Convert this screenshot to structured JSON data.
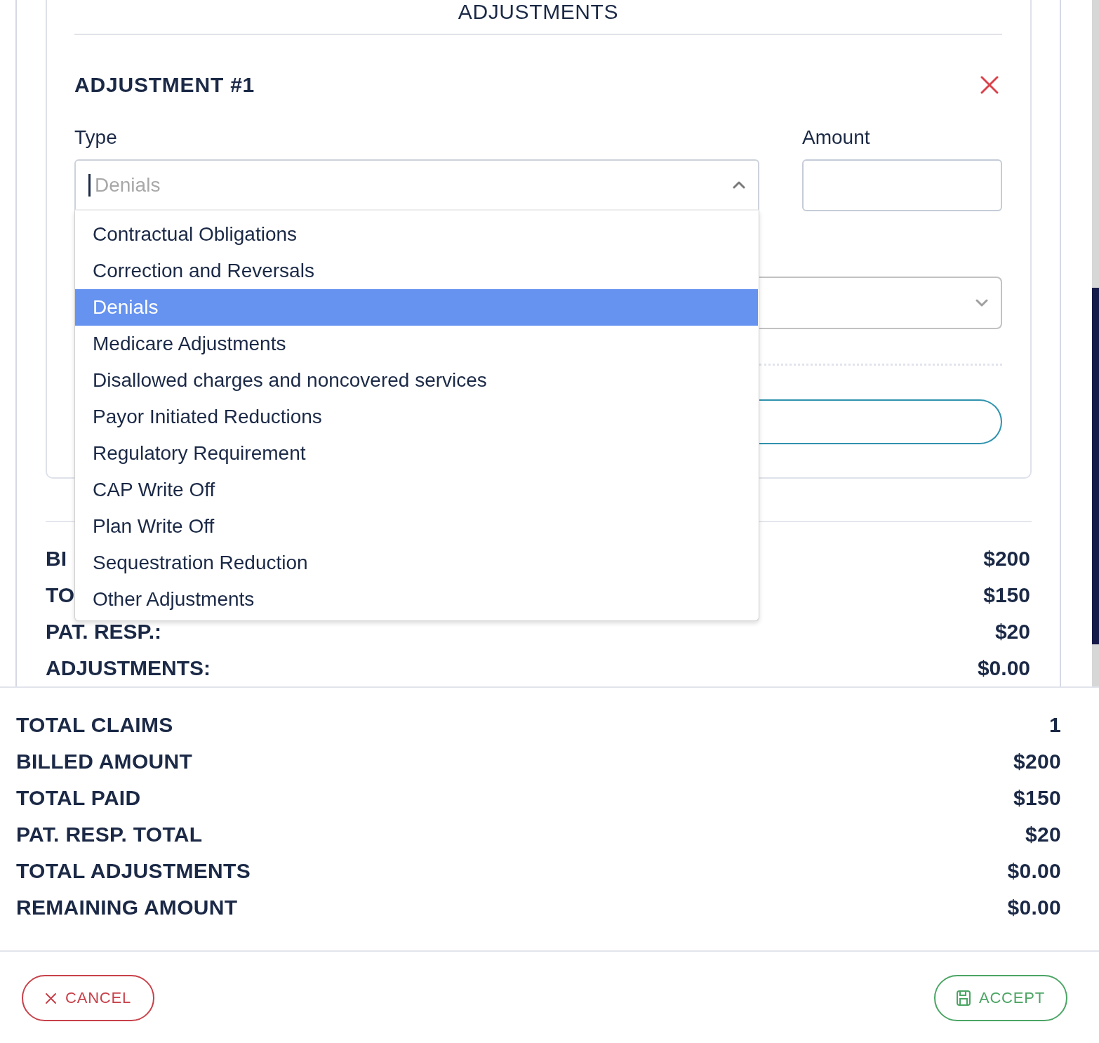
{
  "section_title": "ADJUSTMENTS",
  "adjustment": {
    "title": "ADJUSTMENT #1",
    "type_field": {
      "label": "Type",
      "placeholder": "Denials",
      "expanded": true,
      "options": [
        {
          "label": "Contractual Obligations",
          "selected": false
        },
        {
          "label": "Correction and Reversals",
          "selected": false
        },
        {
          "label": "Denials",
          "selected": true
        },
        {
          "label": "Medicare Adjustments",
          "selected": false
        },
        {
          "label": "Disallowed charges and noncovered services",
          "selected": false
        },
        {
          "label": "Payor Initiated Reductions",
          "selected": false
        },
        {
          "label": "Regulatory Requirement",
          "selected": false
        },
        {
          "label": "CAP Write Off",
          "selected": false
        },
        {
          "label": "Plan Write Off",
          "selected": false
        },
        {
          "label": "Sequestration Reduction",
          "selected": false
        },
        {
          "label": "Other Adjustments",
          "selected": false
        }
      ]
    },
    "amount_field": {
      "label": "Amount"
    }
  },
  "claim_summary": [
    {
      "label": "BI",
      "value": "$200"
    },
    {
      "label": "TO",
      "value": "$150"
    },
    {
      "label": "PAT. RESP.:",
      "value": "$20"
    },
    {
      "label": "ADJUSTMENTS:",
      "value": "$0.00"
    }
  ],
  "totals": [
    {
      "label": "TOTAL CLAIMS",
      "value": "1"
    },
    {
      "label": "BILLED AMOUNT",
      "value": "$200"
    },
    {
      "label": "TOTAL PAID",
      "value": "$150"
    },
    {
      "label": "PAT. RESP. TOTAL",
      "value": "$20"
    },
    {
      "label": "TOTAL ADJUSTMENTS",
      "value": "$0.00"
    },
    {
      "label": "REMAINING AMOUNT",
      "value": "$0.00"
    }
  ],
  "buttons": [
    {
      "kind": "cancel",
      "label": "CANCEL"
    },
    {
      "kind": "accept",
      "label": "ACCEPT"
    }
  ]
}
